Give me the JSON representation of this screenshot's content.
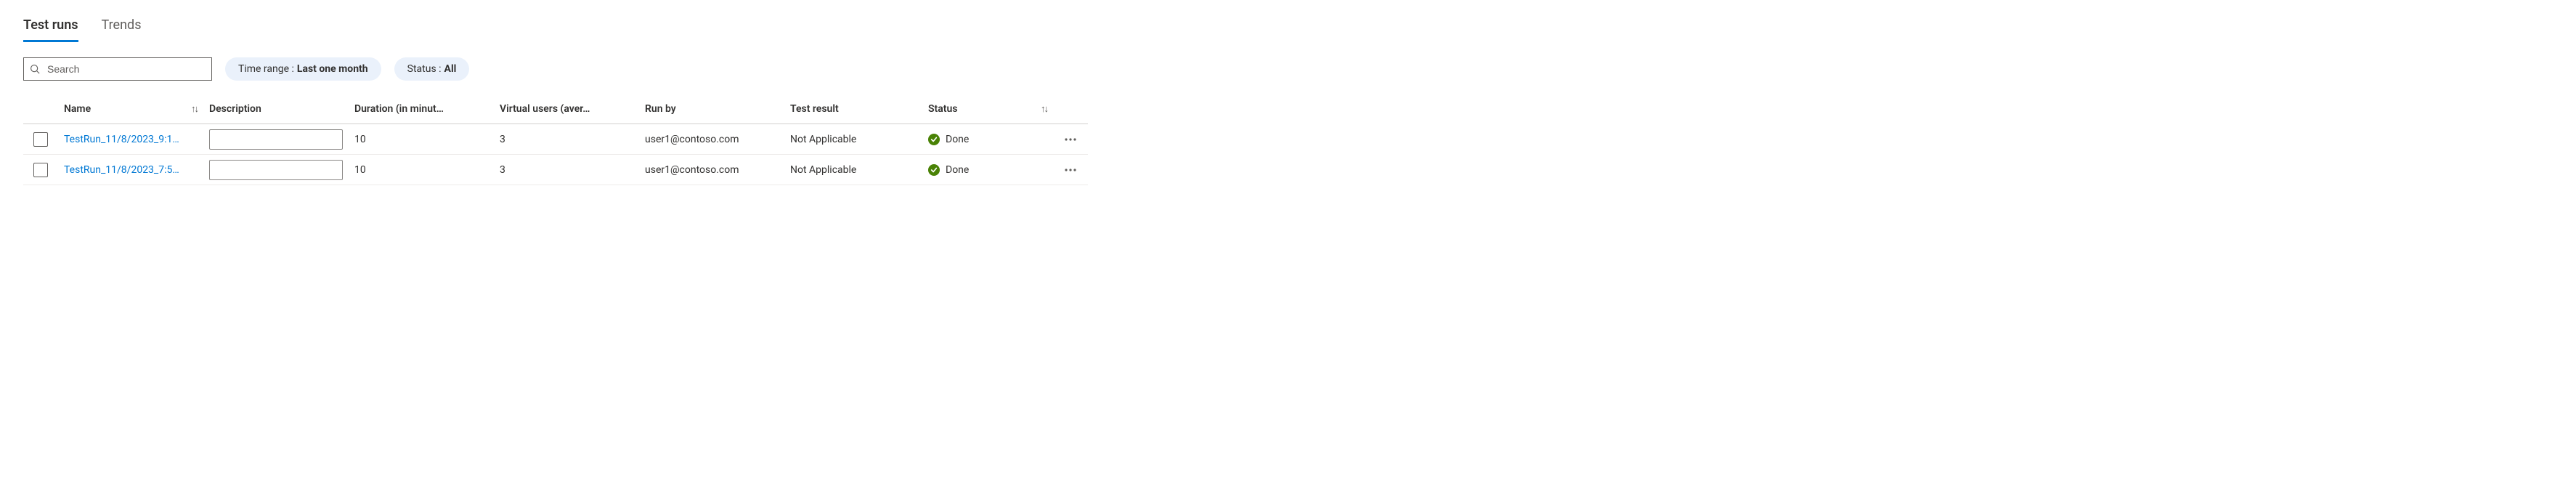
{
  "tabs": {
    "test_runs": "Test runs",
    "trends": "Trends"
  },
  "search": {
    "placeholder": "Search"
  },
  "filters": {
    "time_range_label": "Time range :",
    "time_range_value": "Last one month",
    "status_label": "Status :",
    "status_value": "All"
  },
  "columns": {
    "name": "Name",
    "description": "Description",
    "duration": "Duration (in minut…",
    "virtual_users": "Virtual users (aver…",
    "run_by": "Run by",
    "test_result": "Test result",
    "status": "Status"
  },
  "rows": [
    {
      "name": "TestRun_11/8/2023_9:1…",
      "description": "",
      "duration": "10",
      "virtual_users": "3",
      "run_by": "user1@contoso.com",
      "test_result": "Not Applicable",
      "status": "Done"
    },
    {
      "name": "TestRun_11/8/2023_7:5…",
      "description": "",
      "duration": "10",
      "virtual_users": "3",
      "run_by": "user1@contoso.com",
      "test_result": "Not Applicable",
      "status": "Done"
    }
  ]
}
